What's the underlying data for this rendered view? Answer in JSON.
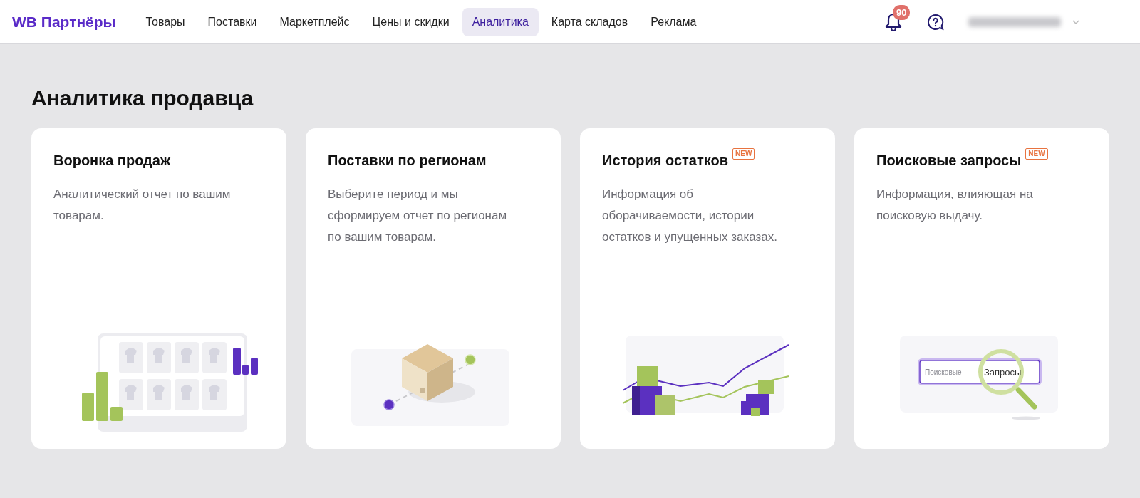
{
  "header": {
    "logo": "WB Партнёры",
    "nav": [
      {
        "label": "Товары",
        "selected": false
      },
      {
        "label": "Поставки",
        "selected": false
      },
      {
        "label": "Маркетплейс",
        "selected": false
      },
      {
        "label": "Цены и скидки",
        "selected": false
      },
      {
        "label": "Аналитика",
        "selected": true
      },
      {
        "label": "Карта складов",
        "selected": false
      },
      {
        "label": "Реклама",
        "selected": false
      }
    ],
    "notifications_count": "90"
  },
  "page_title": "Аналитика продавца",
  "cards": [
    {
      "title": "Воронка продаж",
      "description": "Аналитический отчет по вашим товарам.",
      "illustration": {
        "kind": "funnel"
      }
    },
    {
      "title": "Поставки по регионам",
      "description": "Выберите период и мы сформируем отчет по регионам по вашим товарам.",
      "illustration": {
        "kind": "box"
      }
    },
    {
      "title": "История остатков",
      "new_badge": "NEW",
      "description": "Информация об оборачиваемости, истории остатков и упущенных заказах.",
      "illustration": {
        "kind": "stock"
      }
    },
    {
      "title": "Поисковые запросы",
      "new_badge": "NEW",
      "description": "Информация, влияющая на поисковую выдачу.",
      "illustration": {
        "kind": "search",
        "placeholder_text": "Поисковые",
        "query_text": "Запросы"
      }
    }
  ]
}
